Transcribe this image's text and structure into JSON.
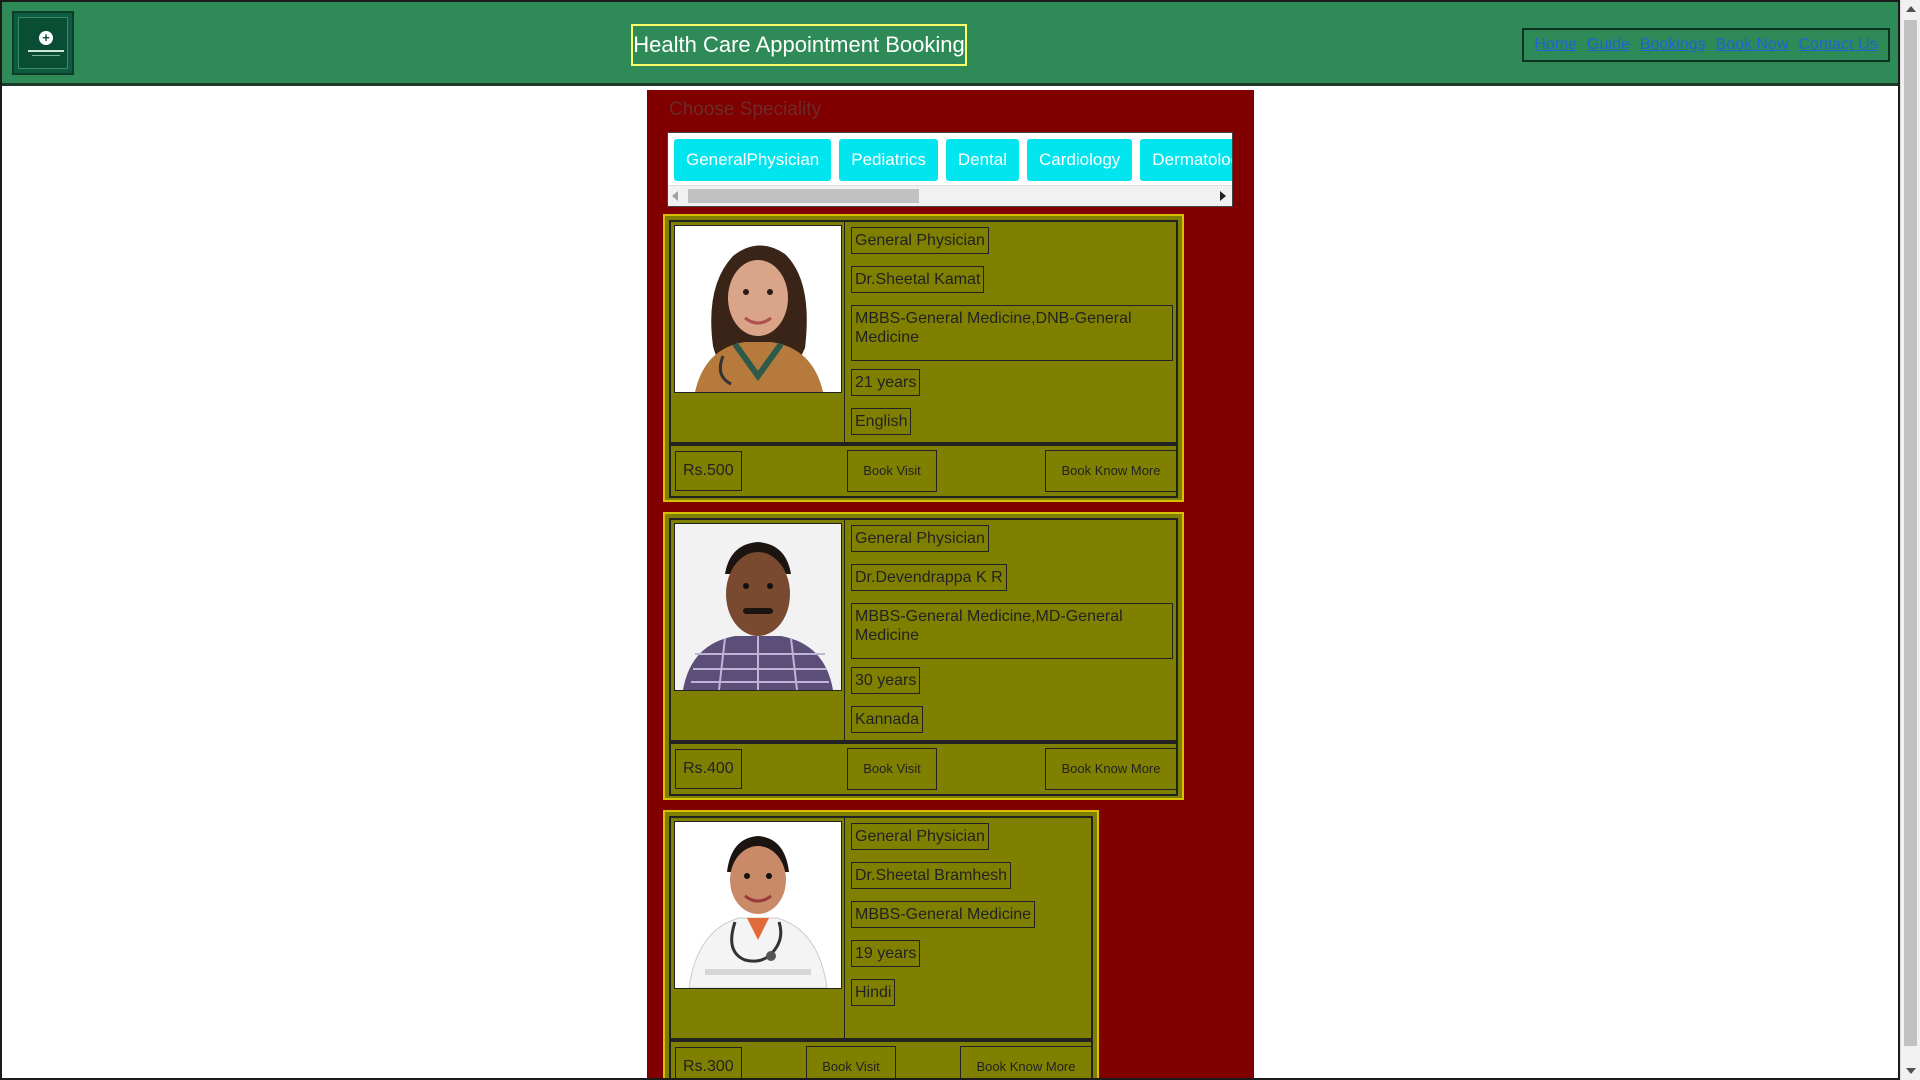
{
  "header": {
    "title": "Health Care Appointment Booking",
    "logo_icon": "medical-cross-logo",
    "nav": [
      {
        "label": "Home"
      },
      {
        "label": "Guide"
      },
      {
        "label": "Bookings"
      },
      {
        "label": "Book Now"
      },
      {
        "label": "Contact Us"
      }
    ]
  },
  "speciality": {
    "title": "Choose Speciality",
    "options": [
      {
        "label": "GeneralPhysician"
      },
      {
        "label": "Pediatrics"
      },
      {
        "label": "Dental"
      },
      {
        "label": "Cardiology"
      },
      {
        "label": "Dermatology"
      }
    ]
  },
  "doctors": [
    {
      "speciality": "General Physician",
      "name": "Dr.Sheetal Kamat",
      "qualification": "MBBS-General Medicine,DNB-General Medicine",
      "experience": "21 years",
      "language": "English",
      "fee": "Rs.500",
      "book_visit": "Book Visit",
      "know_more": "Book Know More"
    },
    {
      "speciality": "General Physician",
      "name": "Dr.Devendrappa K R",
      "qualification": "MBBS-General Medicine,MD-General Medicine",
      "experience": "30 years",
      "language": "Kannada",
      "fee": "Rs.400",
      "book_visit": "Book Visit",
      "know_more": "Book Know More"
    },
    {
      "speciality": "General Physician",
      "name": "Dr.Sheetal Bramhesh",
      "qualification": "MBBS-General Medicine",
      "experience": "19 years",
      "language": "Hindi",
      "fee": "Rs.300",
      "book_visit": "Book Visit",
      "know_more": "Book Know More"
    }
  ],
  "colors": {
    "header_bg": "#2e8b57",
    "panel_bg": "#800000",
    "card_bg": "#808000",
    "card_border": "#d6c000",
    "speciality_button": "#00e5ee",
    "nav_link": "#1e63d6"
  }
}
